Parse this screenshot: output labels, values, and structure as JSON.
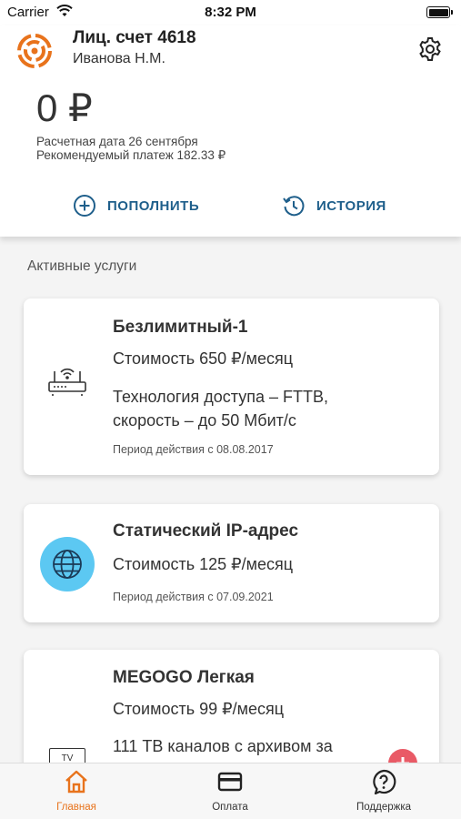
{
  "status_bar": {
    "carrier": "Carrier",
    "time": "8:32 PM"
  },
  "account": {
    "title": "Лиц. счет 4618",
    "holder": "Иванова Н.М.",
    "balance": "0 ₽",
    "billing_date": "Расчетная дата 26 сентября",
    "recommended_payment": "Рекомендуемый платеж 182.33 ₽"
  },
  "actions": {
    "topup": "ПОПОЛНИТЬ",
    "history": "ИСТОРИЯ"
  },
  "section_title": "Активные услуги",
  "services": [
    {
      "title": "Безлимитный-1",
      "price": "Стоимость 650 ₽/месяц",
      "details_1": "Технология доступа – FTTB,",
      "details_2": "скорость – до 50 Мбит/с",
      "period": "Период действия с 08.08.2017",
      "icon": "router-icon"
    },
    {
      "title": "Статический IP-адрес",
      "price": "Стоимость 125 ₽/месяц",
      "period": "Период действия с 07.09.2021",
      "icon": "globe-icon"
    },
    {
      "title": "MEGOGO Легкая",
      "price": "Стоимость 99 ₽/месяц",
      "details_1": "111 ТВ каналов с архивом за",
      "icon": "tv-icon",
      "icon_text": "TV"
    }
  ],
  "tabs": [
    {
      "label": "Главная",
      "icon": "home-icon",
      "active": true
    },
    {
      "label": "Оплата",
      "icon": "card-icon"
    },
    {
      "label": "Поддержка",
      "icon": "support-icon"
    }
  ],
  "colors": {
    "accent": "#e8731c",
    "action_blue": "#1f5f8b",
    "globe": "#5cc8f2",
    "fab": "#e95a66"
  }
}
